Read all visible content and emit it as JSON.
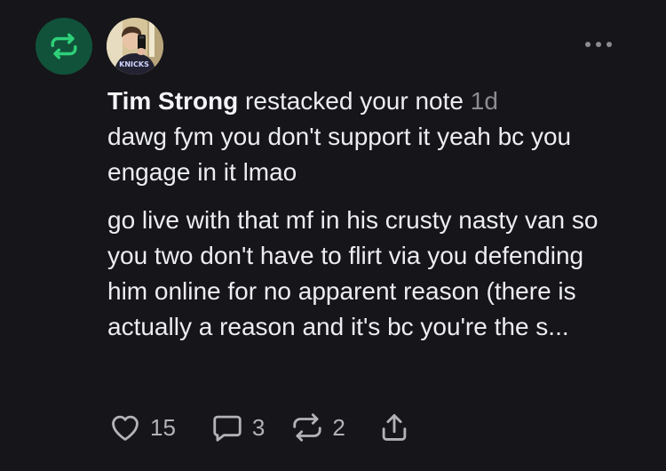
{
  "notification": {
    "type_icon": "restack-icon",
    "accent_color": "#11533a",
    "icon_color": "#2fd07a",
    "author": "Tim Strong",
    "action_text": "restacked your note",
    "time_ago": "1d",
    "more_icon": "more-horizontal-icon",
    "avatar_text": "KNICKS",
    "note_paragraphs": [
      "dawg fym you don't support it yeah bc you engage in it lmao",
      "go live with that mf in his crusty nasty van so you two don't have to flirt via you defending him online for no apparent reason (there is actually a reason and it's bc you're the s..."
    ]
  },
  "actions": {
    "likes": "15",
    "comments": "3",
    "restacks": "2",
    "like_icon": "heart-icon",
    "comment_icon": "comment-bubble-icon",
    "restack_icon": "restack-icon",
    "share_icon": "share-icon"
  }
}
